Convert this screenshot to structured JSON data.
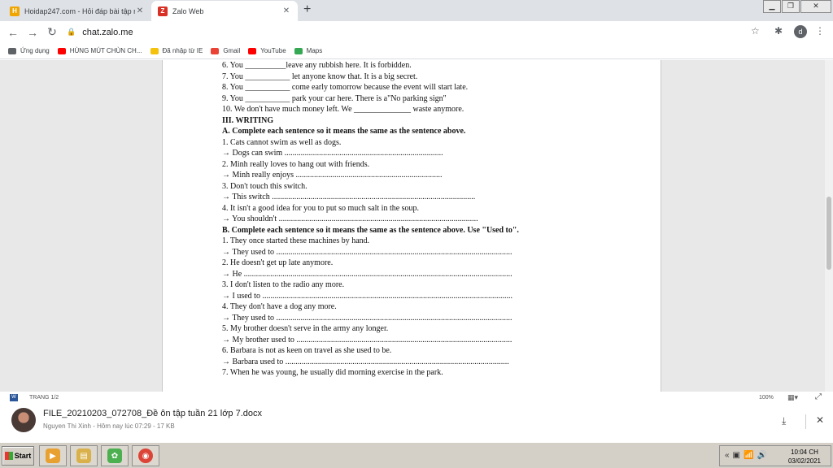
{
  "tabs": [
    {
      "title": "Hoidap247.com - Hỏi đáp bài tập nh",
      "favicon_letter": "H",
      "favicon_color": "#f0a500"
    },
    {
      "title": "Zalo Web",
      "favicon_letter": "Z",
      "favicon_color": "#d93025"
    }
  ],
  "address_bar": {
    "url": "chat.zalo.me"
  },
  "profile_initial": "d",
  "bookmarks": [
    {
      "label": "Ứng dụng",
      "color": "#5f6368"
    },
    {
      "label": "HÙNG MÚT CHÙN CH...",
      "color": "#ff0000"
    },
    {
      "label": "Đã nhập từ IE",
      "color": "#f4c20d"
    },
    {
      "label": "Gmail",
      "color": "#ea4335"
    },
    {
      "label": "YouTube",
      "color": "#ff0000"
    },
    {
      "label": "Maps",
      "color": "#34a853"
    }
  ],
  "document": {
    "lines": [
      {
        "text": "6.   You __________leave any rubbish here. It is forbidden.",
        "bold": false
      },
      {
        "text": "7.   You ___________ let anyone know that. It is a big secret.",
        "bold": false
      },
      {
        "text": "8.   You ___________ come early tomorrow because the event will start late.",
        "bold": false
      },
      {
        "text": "9.   You ___________ park your car here. There is a\"No parking sign\"",
        "bold": false
      },
      {
        "text": "10.  We don't have much money left. We ______________ waste anymore.",
        "bold": false
      },
      {
        "text": "III. WRITING",
        "bold": true
      },
      {
        "text": "A. Complete each sentence so it means the same as the sentence above.",
        "bold": true
      },
      {
        "text": "1.   Cats cannot swim as well as dogs.",
        "bold": false
      },
      {
        "text": "→  Dogs can swim ..............................................................................",
        "bold": false
      },
      {
        "text": "2.   Minh really loves to hang out with friends.",
        "bold": false
      },
      {
        "text": "→  Minh really enjoys ........................................................................",
        "bold": false
      },
      {
        "text": "3.   Don't touch this switch.",
        "bold": false
      },
      {
        "text": "→  This switch ....................................................................................................",
        "bold": false
      },
      {
        "text": "4.   It isn't a good idea for you to put so much salt in the soup.",
        "bold": false
      },
      {
        "text": "→  You shouldn't ..................................................................................................",
        "bold": false
      },
      {
        "text": "B. Complete each sentence so it means the same as the sentence above. Use \"Used to\".",
        "bold": true
      },
      {
        "text": "1.   They once started these machines by hand.",
        "bold": false
      },
      {
        "text": "→  They used to ....................................................................................................................",
        "bold": false
      },
      {
        "text": "2.   He doesn't get up late anymore.",
        "bold": false
      },
      {
        "text": "→  He ....................................................................................................................................",
        "bold": false
      },
      {
        "text": "3.   I don't listen to the radio any more.",
        "bold": false
      },
      {
        "text": "→  I used to ...........................................................................................................................",
        "bold": false
      },
      {
        "text": "4.   They don't have a dog any more.",
        "bold": false
      },
      {
        "text": "→  They used to ....................................................................................................................",
        "bold": false
      },
      {
        "text": "5.   My brother doesn't serve in the army any longer.",
        "bold": false
      },
      {
        "text": "→  My brother used to ..........................................................................................................",
        "bold": false
      },
      {
        "text": "6.   Barbara is not as keen on travel as she used to be.",
        "bold": false
      },
      {
        "text": "→  Barbara used to ..............................................................................................................",
        "bold": false
      },
      {
        "text": "7.   When he was young, he usually did morning exercise in the park.",
        "bold": false
      }
    ]
  },
  "status_bar": {
    "page_label": "TRANG 1/2",
    "zoom": "100%"
  },
  "file": {
    "name": "FILE_20210203_072708_Đề ôn tập tuần 21 lớp 7.docx",
    "meta": "Nguyen Thi Xinh - Hôm nay lúc 07:29 - 17 KB"
  },
  "taskbar": {
    "start_label": "Start",
    "apps": [
      {
        "name": "media",
        "color": "#e8a030",
        "glyph": "▶"
      },
      {
        "name": "explorer",
        "color": "#d9b04a",
        "glyph": "▤"
      },
      {
        "name": "green-app",
        "color": "#4caf50",
        "glyph": "✿"
      },
      {
        "name": "chrome",
        "color": "#db4437",
        "glyph": "◉"
      }
    ],
    "time": "10:04 CH",
    "date": "03/02/2021"
  }
}
